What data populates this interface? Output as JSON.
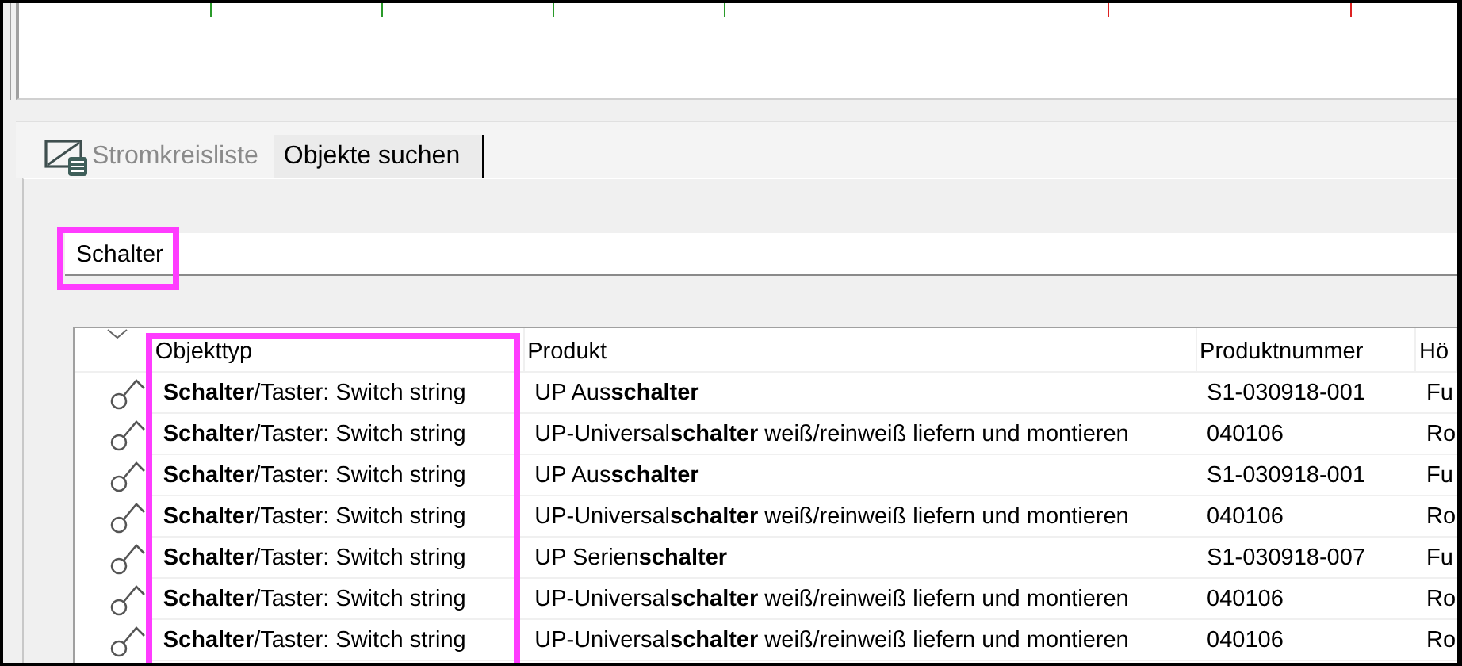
{
  "tabs": [
    {
      "label": "Stromkreisliste",
      "selected": false,
      "disabled": true
    },
    {
      "label": "Objekte suchen",
      "selected": true,
      "disabled": false
    }
  ],
  "search": {
    "value": "Schalter",
    "highlighted": true
  },
  "table": {
    "columns": [
      {
        "label": "Objekttyp",
        "highlighted": true
      },
      {
        "label": "Produkt",
        "highlighted": false
      },
      {
        "label": "Produktnummer",
        "highlighted": false
      },
      {
        "label": "Hö",
        "highlighted": false
      }
    ],
    "rows": [
      {
        "cells": [
          "**Schalter**/Taster: Switch string",
          "UP Aus**schalter**",
          "S1-030918-001",
          "Fu"
        ]
      },
      {
        "cells": [
          "**Schalter**/Taster: Switch string",
          "UP-Universal**schalter** weiß/reinweiß liefern und montieren",
          "040106",
          "Ro"
        ]
      },
      {
        "cells": [
          "**Schalter**/Taster: Switch string",
          "UP Aus**schalter**",
          "S1-030918-001",
          "Fu"
        ]
      },
      {
        "cells": [
          "**Schalter**/Taster: Switch string",
          "UP-Universal**schalter** weiß/reinweiß liefern und montieren",
          "040106",
          "Ro"
        ]
      },
      {
        "cells": [
          "**Schalter**/Taster: Switch string",
          "UP Serien**schalter**",
          "S1-030918-007",
          "Fu"
        ]
      },
      {
        "cells": [
          "**Schalter**/Taster: Switch string",
          "UP-Universal**schalter** weiß/reinweiß liefern und montieren",
          "040106",
          "Ro"
        ]
      },
      {
        "cells": [
          "**Schalter**/Taster: Switch string",
          "UP-Universal**schalter** weiß/reinweiß liefern und montieren",
          "040106",
          "Ro"
        ]
      }
    ]
  }
}
